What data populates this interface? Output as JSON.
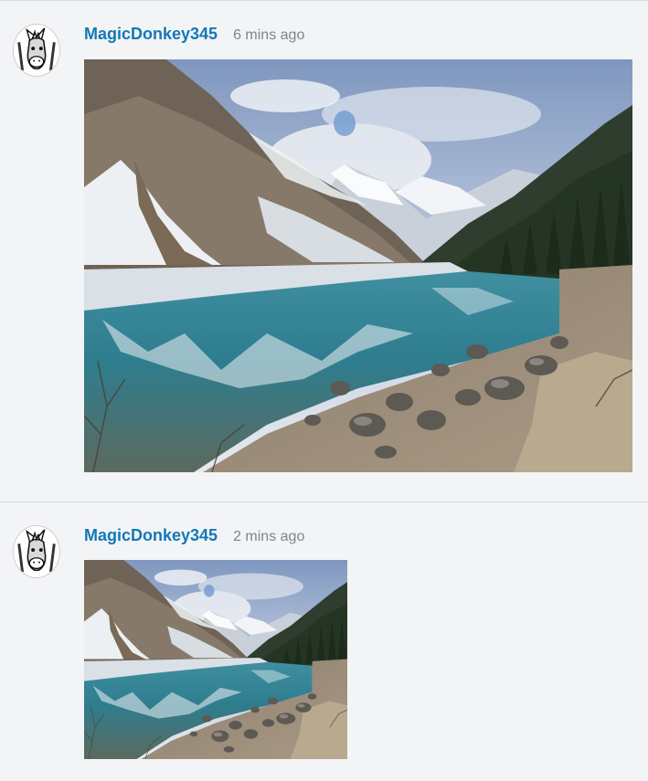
{
  "posts": [
    {
      "username": "MagicDonkey345",
      "timestamp": "6 mins ago",
      "image": {
        "subject": "mountain-lake-photo"
      }
    },
    {
      "username": "MagicDonkey345",
      "timestamp": "2 mins ago",
      "image": {
        "subject": "mountain-lake-photo"
      }
    }
  ],
  "colors": {
    "username": "#1378b8",
    "timestamp": "#7f848b",
    "background": "#f3f4f6",
    "divider": "#d9dce1"
  },
  "icons": {
    "avatar": "donkey-avatar-icon"
  }
}
